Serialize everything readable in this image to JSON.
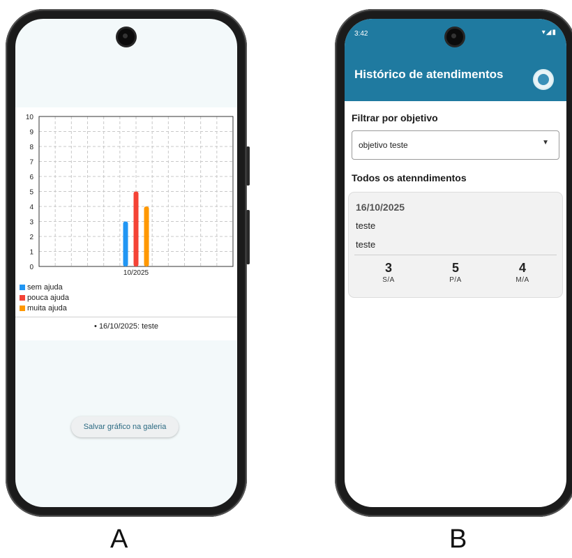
{
  "labels": {
    "a": "A",
    "b": "B"
  },
  "screen_a": {
    "chart_data": {
      "type": "bar",
      "categories": [
        "10/2025"
      ],
      "series": [
        {
          "name": "sem ajuda",
          "values": [
            3
          ],
          "color": "#2196f3"
        },
        {
          "name": "pouca ajuda",
          "values": [
            5
          ],
          "color": "#f44336"
        },
        {
          "name": "muita ajuda",
          "values": [
            4
          ],
          "color": "#ff9800"
        }
      ],
      "yticks": [
        "0",
        "1",
        "2",
        "3",
        "4",
        "5",
        "6",
        "7",
        "8",
        "9",
        "10"
      ],
      "ylim": [
        0,
        10
      ],
      "grid": true,
      "legend_placement": "bottom-left"
    },
    "note": "• 16/10/2025: teste",
    "save_button": "Salvar gráfico na galeria"
  },
  "screen_b": {
    "status_time": "3:42",
    "status_icons": "▾◢▮",
    "title": "Histórico de atendimentos",
    "filter_label": "Filtrar por objetivo",
    "dropdown_value": "objetivo teste",
    "list_label": "Todos os atenndimentos",
    "card": {
      "date": "16/10/2025",
      "line1": "teste",
      "line2": "teste",
      "stats": [
        {
          "value": "3",
          "label": "S/A"
        },
        {
          "value": "5",
          "label": "P/A"
        },
        {
          "value": "4",
          "label": "M/A"
        }
      ]
    }
  }
}
